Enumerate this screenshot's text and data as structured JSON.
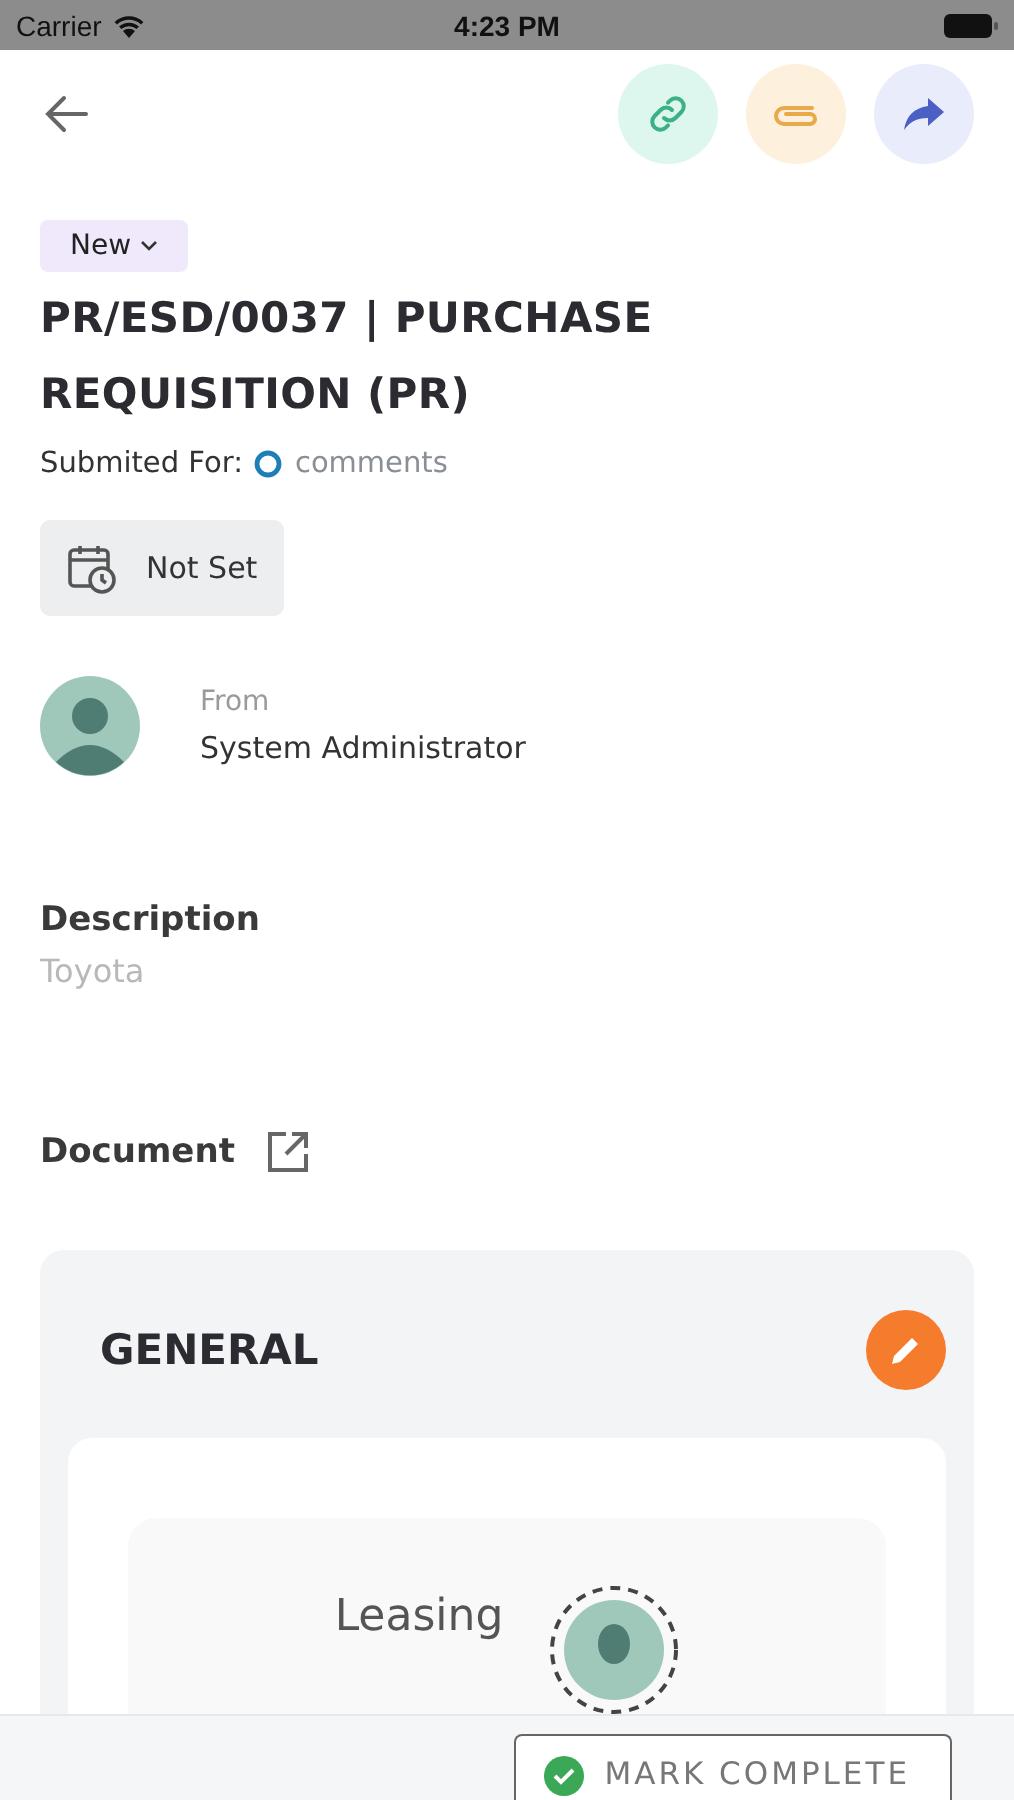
{
  "status_bar": {
    "carrier": "Carrier",
    "time": "4:23 PM"
  },
  "header": {
    "actions": [
      {
        "kind": "link"
      },
      {
        "kind": "attach"
      },
      {
        "kind": "forward"
      }
    ]
  },
  "status_badge": {
    "label": "New"
  },
  "title": "PR/ESD/0037 | PURCHASE REQUISITION (PR)",
  "submitted_for": {
    "label": "Submited For:",
    "value": "comments"
  },
  "due_date": "Not Set",
  "from": {
    "label": "From",
    "name": "System Administrator"
  },
  "description": {
    "label": "Description",
    "value": "Toyota"
  },
  "document": {
    "label": "Document"
  },
  "section": {
    "title": "GENERAL",
    "item": "Leasing"
  },
  "footer": {
    "button": "MARK COMPLETE"
  }
}
